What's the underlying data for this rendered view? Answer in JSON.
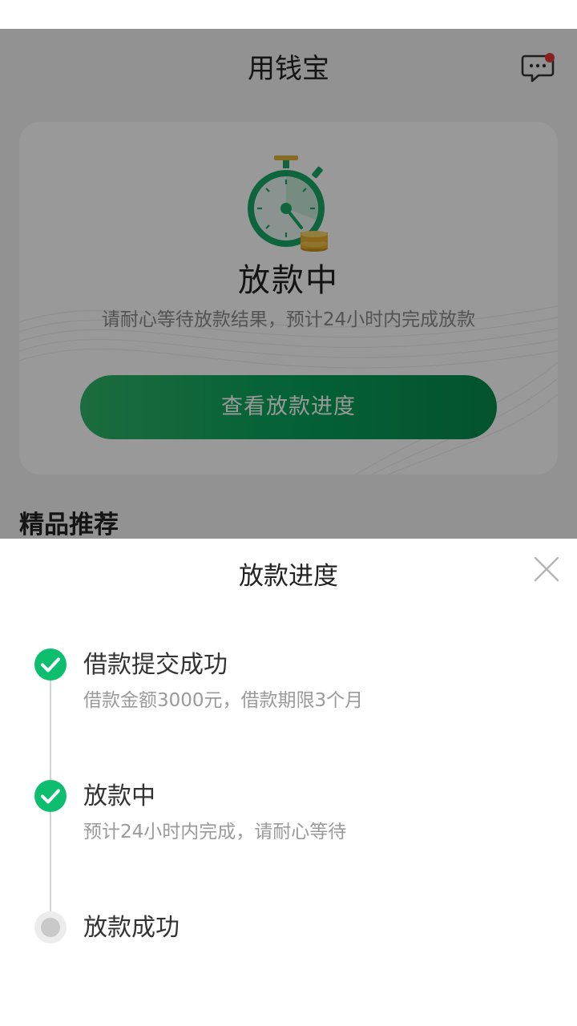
{
  "header": {
    "title": "用钱宝",
    "message_icon": "chat-bubble-icon",
    "has_unread": true
  },
  "status_card": {
    "icon": "stopwatch-coins-icon",
    "title": "放款中",
    "subtitle": "请耐心等待放款结果，预计24小时内完成放款",
    "button_label": "查看放款进度"
  },
  "recommend": {
    "title": "精品推荐"
  },
  "sheet": {
    "title": "放款进度",
    "close_icon": "close-icon",
    "steps": [
      {
        "title": "借款提交成功",
        "desc": "借款金额3000元，借款期限3个月",
        "state": "done"
      },
      {
        "title": "放款中",
        "desc": "预计24小时内完成，请耐心等待",
        "state": "done"
      },
      {
        "title": "放款成功",
        "desc": "",
        "state": "pending"
      }
    ]
  },
  "colors": {
    "accent_green": "#07a35a",
    "check_green": "#0cbe6e",
    "unread_dot": "#e53935"
  }
}
